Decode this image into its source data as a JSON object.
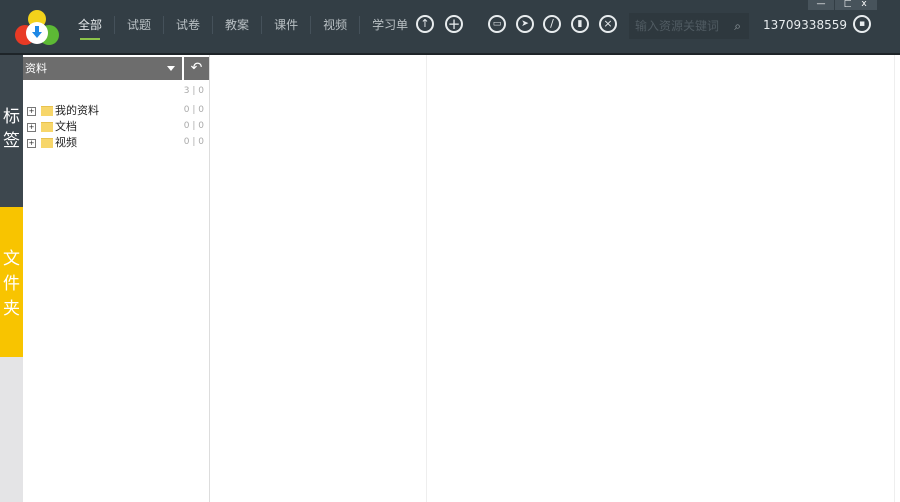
{
  "nav": [
    "全部",
    "试题",
    "试卷",
    "教案",
    "课件",
    "视频",
    "学习单"
  ],
  "search": {
    "placeholder": "输入资源关键词"
  },
  "user": {
    "phone": "13709338559"
  },
  "window": {
    "min": "—",
    "max": "□",
    "close": "x"
  },
  "side_tabs": {
    "tags": "标签",
    "folders": "文件夹"
  },
  "panel": {
    "select": "资料",
    "back": "↶",
    "total": "3 | 0",
    "items": [
      {
        "name": "我的资料",
        "count": "0 | 0"
      },
      {
        "name": "文档",
        "count": "0 | 0"
      },
      {
        "name": "视频",
        "count": "0 | 0"
      }
    ]
  }
}
